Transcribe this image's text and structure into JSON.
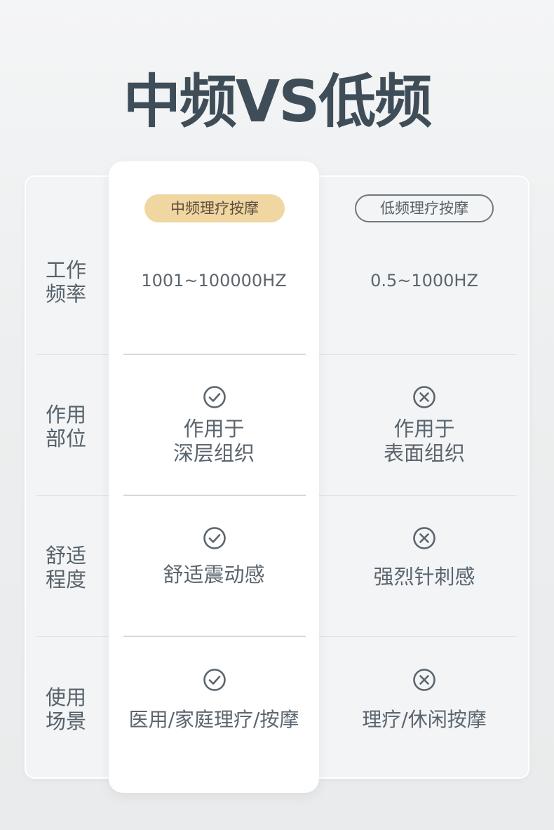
{
  "title": "中频VS低频",
  "columns": {
    "mid": "中频理疗按摩",
    "low": "低频理疗按摩"
  },
  "rows": [
    {
      "label_line1": "工作",
      "label_line2": "频率",
      "mid": "1001~100000HZ",
      "low": "0.5~1000HZ"
    },
    {
      "label_line1": "作用",
      "label_line2": "部位",
      "mid_line1": "作用于",
      "mid_line2": "深层组织",
      "low_line1": "作用于",
      "low_line2": "表面组织",
      "mid_icon": "check-circle-icon",
      "low_icon": "x-circle-icon"
    },
    {
      "label_line1": "舒适",
      "label_line2": "程度",
      "mid": "舒适震动感",
      "low": "强烈针刺感",
      "mid_icon": "check-circle-icon",
      "low_icon": "x-circle-icon"
    },
    {
      "label_line1": "使用",
      "label_line2": "场景",
      "mid": "医用/家庭理疗/按摩",
      "low": "理疗/休闲按摩",
      "mid_icon": "check-circle-icon",
      "low_icon": "x-circle-icon"
    }
  ],
  "colors": {
    "accent_pill": "#f0d6a0",
    "title": "#3f4d58",
    "text": "#56616a"
  }
}
